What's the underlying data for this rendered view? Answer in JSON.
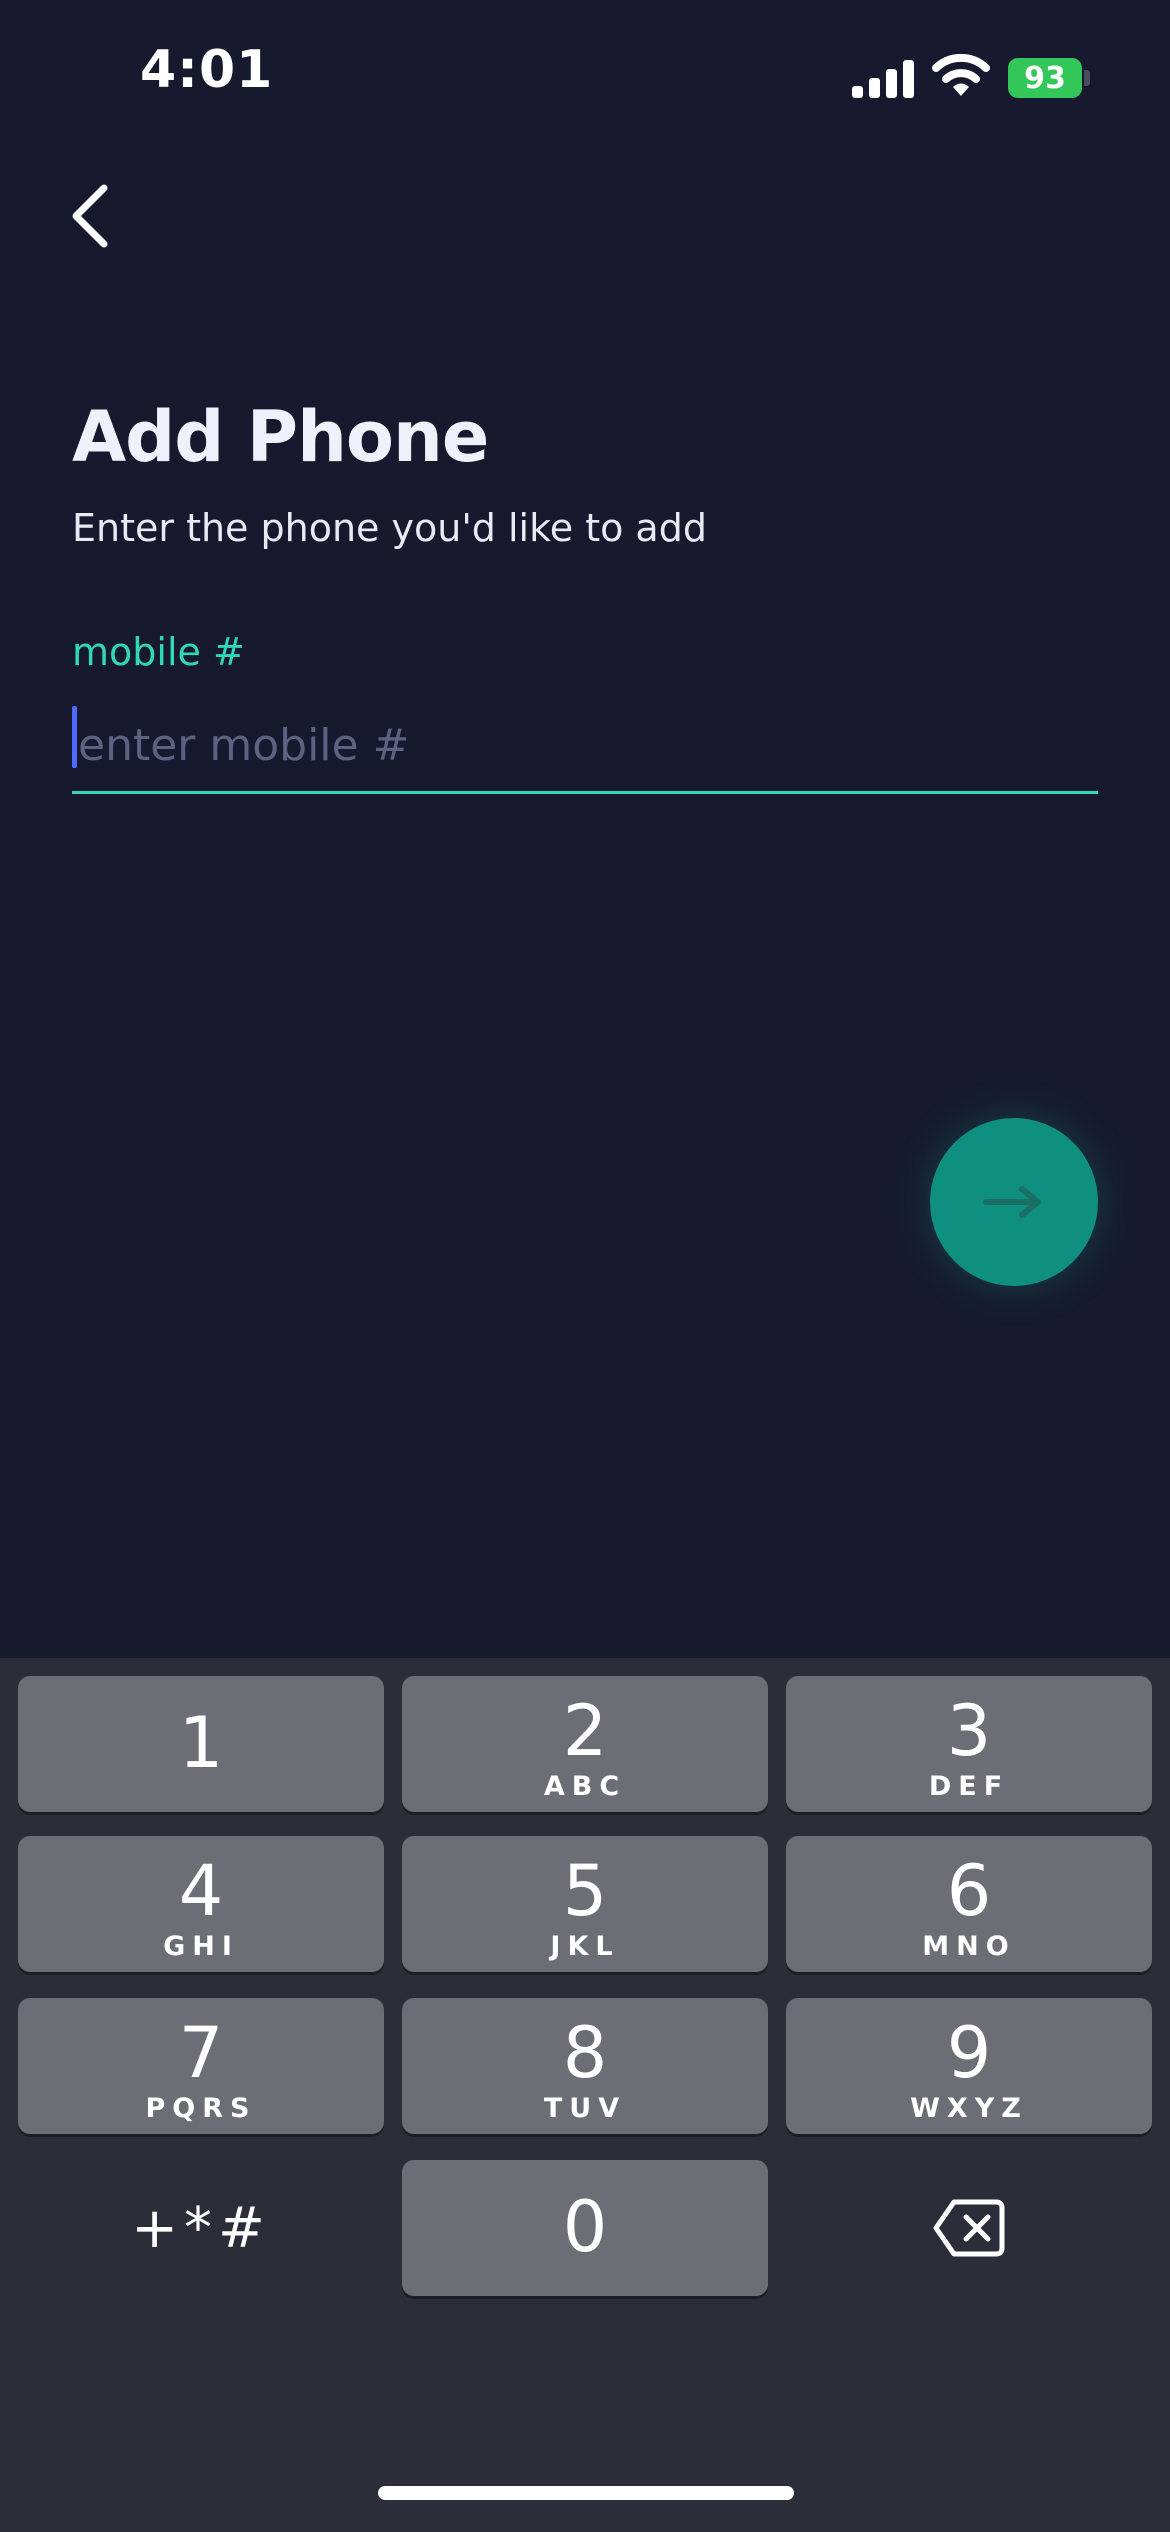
{
  "status_bar": {
    "time": "4:01",
    "battery": "93",
    "battery_color": "#33c759"
  },
  "icons": {
    "back": "chevron-left-icon",
    "next": "arrow-right-icon",
    "delete": "backspace-icon",
    "signal": "cellular-signal-icon",
    "wifi": "wifi-icon",
    "battery": "battery-charging-icon"
  },
  "header": {
    "title": "Add Phone",
    "subtitle": "Enter the phone you'd like to add"
  },
  "form": {
    "label": "mobile #",
    "value": "",
    "placeholder": "enter mobile #"
  },
  "colors": {
    "background": "#171a2e",
    "accent": "#2fd8b8",
    "fab": "#0f8f80",
    "caret": "#4f6bff"
  },
  "keypad": {
    "keys": [
      {
        "digit": "1",
        "letters": ""
      },
      {
        "digit": "2",
        "letters": "ABC"
      },
      {
        "digit": "3",
        "letters": "DEF"
      },
      {
        "digit": "4",
        "letters": "GHI"
      },
      {
        "digit": "5",
        "letters": "JKL"
      },
      {
        "digit": "6",
        "letters": "MNO"
      },
      {
        "digit": "7",
        "letters": "PQRS"
      },
      {
        "digit": "8",
        "letters": "TUV"
      },
      {
        "digit": "9",
        "letters": "WXYZ"
      },
      {
        "digit": "0",
        "letters": ""
      }
    ],
    "symbols": "+*#"
  }
}
